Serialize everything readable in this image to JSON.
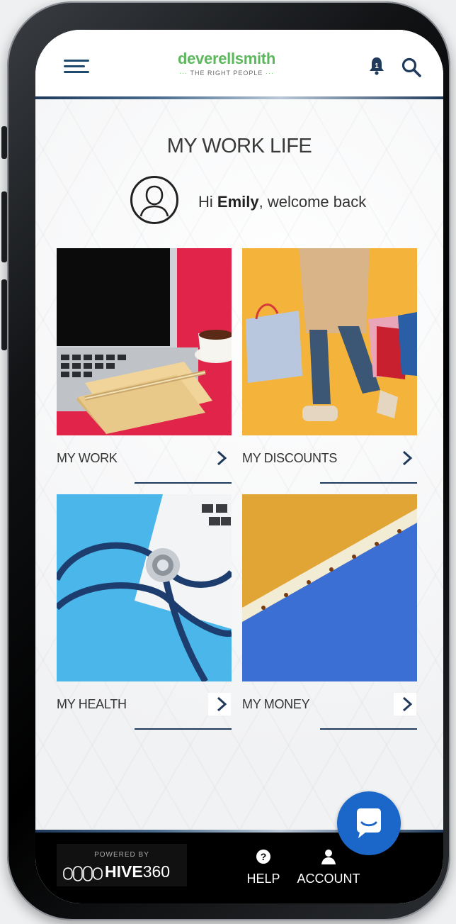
{
  "header": {
    "logo_main": "deverellsmith",
    "logo_sub": "THE RIGHT PEOPLE",
    "logo_dots": "···"
  },
  "page": {
    "title": "MY WORK LIFE",
    "greeting_prefix": "Hi ",
    "user_name": "Emily",
    "greeting_suffix": ", welcome back"
  },
  "cards": [
    {
      "label": "MY WORK"
    },
    {
      "label": "MY DISCOUNTS"
    },
    {
      "label": "MY HEALTH"
    },
    {
      "label": "MY MONEY"
    }
  ],
  "footer": {
    "powered_by": "POWERED BY",
    "brand_bold": "HIVE",
    "brand_num": "360",
    "help_label": "HELP",
    "account_label": "ACCOUNT"
  },
  "colors": {
    "brand_green": "#5cb85c",
    "navy": "#1f3a5a",
    "chat_blue": "#1a66c9"
  }
}
